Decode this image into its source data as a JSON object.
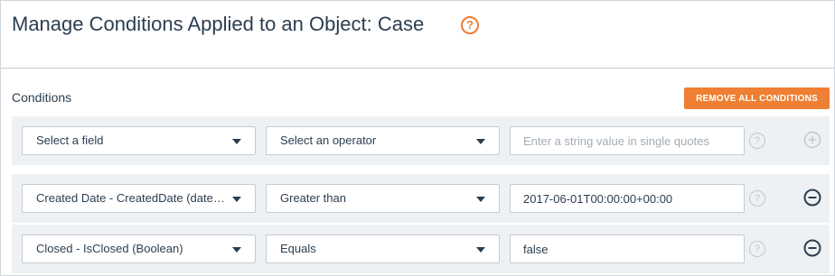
{
  "header": {
    "title": "Manage Conditions Applied to an Object: Case",
    "help_icon": "help-circle-icon",
    "accent_color": "#ef7f33"
  },
  "conditions": {
    "label": "Conditions",
    "remove_all_label": "REMOVE ALL CONDITIONS",
    "new_condition": {
      "field": "Select a field",
      "operator": "Select an operator",
      "value": "",
      "value_placeholder": "Enter a string value in single quotes",
      "action_icon": "add-circle-icon"
    },
    "rows": [
      {
        "field": "Created Date - CreatedDate (datetime)",
        "operator": "Greater than",
        "value": "2017-06-01T00:00:00+00:00",
        "action_icon": "remove-circle-icon"
      },
      {
        "field": "Closed - IsClosed (Boolean)",
        "operator": "Equals",
        "value": "false",
        "action_icon": "remove-circle-icon"
      }
    ]
  }
}
